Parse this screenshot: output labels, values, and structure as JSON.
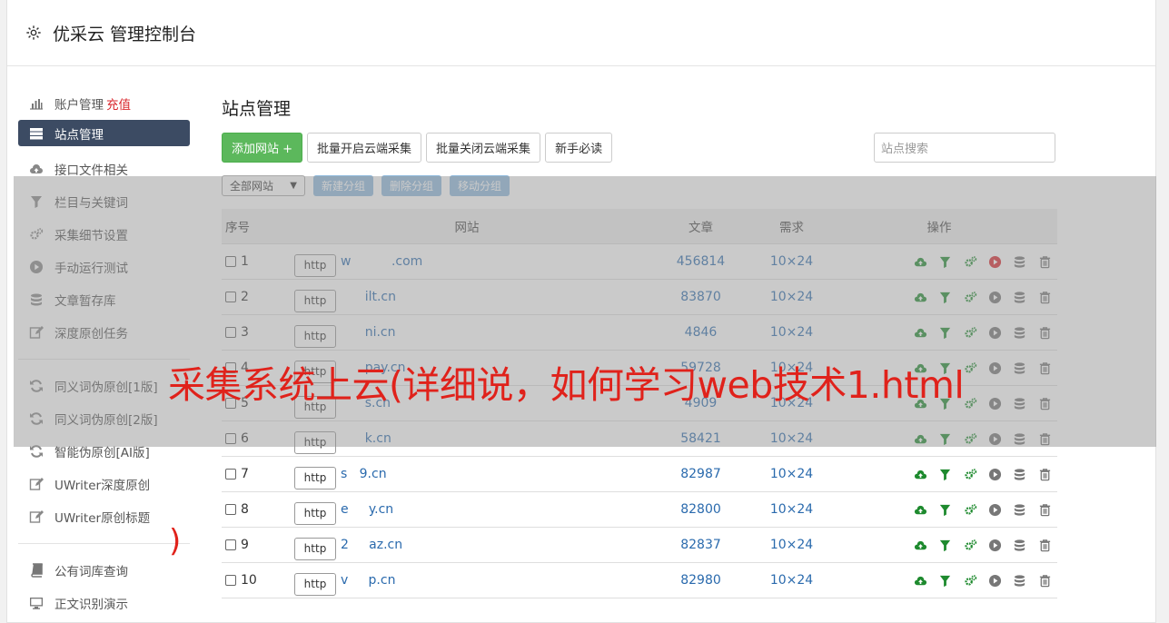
{
  "header": {
    "title": "优采云 管理控制台"
  },
  "sidebar": {
    "items": [
      {
        "label": "账户管理",
        "extra": "充值",
        "icon": "bar-chart-icon"
      },
      {
        "label": "站点管理",
        "icon": "server-icon",
        "active": true
      },
      {
        "label": "接口文件相关",
        "icon": "cloud-upload-icon"
      },
      {
        "label": "栏目与关键词",
        "icon": "filter-icon"
      },
      {
        "label": "采集细节设置",
        "icon": "gears-icon"
      },
      {
        "label": "手动运行测试",
        "icon": "play-circle-icon"
      },
      {
        "label": "文章暂存库",
        "icon": "database-icon"
      },
      {
        "label": "深度原创任务",
        "icon": "edit-icon"
      }
    ],
    "items2": [
      {
        "label": "同义词伪原创[1版]",
        "icon": "refresh-icon"
      },
      {
        "label": "同义词伪原创[2版]",
        "icon": "refresh-icon"
      },
      {
        "label": "智能伪原创[AI版]",
        "icon": "refresh-icon"
      },
      {
        "label": "UWriter深度原创",
        "icon": "edit-icon"
      },
      {
        "label": "UWriter原创标题",
        "icon": "edit-icon"
      }
    ],
    "items3": [
      {
        "label": "公有词库查询",
        "icon": "book-icon"
      },
      {
        "label": "正文识别演示",
        "icon": "monitor-icon"
      }
    ]
  },
  "main": {
    "title": "站点管理",
    "buttons": {
      "add": "添加网站 +",
      "batch_open": "批量开启云端采集",
      "batch_close": "批量关闭云端采集",
      "guide": "新手必读"
    },
    "search_placeholder": "站点搜索",
    "group_select": "全部网站",
    "group_buttons": {
      "new": "新建分组",
      "delete": "删除分组",
      "move": "移动分组"
    },
    "columns": {
      "no": "序号",
      "site": "网站",
      "articles": "文章",
      "demand": "需求",
      "ops": "操作"
    },
    "rows": [
      {
        "no": "1",
        "proto": "http",
        "domain": "w          .com",
        "articles": "456814",
        "demand": "10×24",
        "running": true
      },
      {
        "no": "2",
        "proto": "http",
        "domain": "      ilt.cn",
        "articles": "83870",
        "demand": "10×24",
        "running": false
      },
      {
        "no": "3",
        "proto": "http",
        "domain": "      ni.cn",
        "articles": "4846",
        "demand": "10×24",
        "running": false
      },
      {
        "no": "4",
        "proto": "http",
        "domain": "      pay.cn",
        "articles": "59728",
        "demand": "10×24",
        "running": false
      },
      {
        "no": "5",
        "proto": "http",
        "domain": "      s.cn",
        "articles": "4909",
        "demand": "10×24",
        "running": false
      },
      {
        "no": "6",
        "proto": "http",
        "domain": "      k.cn",
        "articles": "58421",
        "demand": "10×24",
        "running": false
      },
      {
        "no": "7",
        "proto": "http",
        "domain": "s   9.cn",
        "articles": "82987",
        "demand": "10×24",
        "running": false
      },
      {
        "no": "8",
        "proto": "http",
        "domain": "e     y.cn",
        "articles": "82800",
        "demand": "10×24",
        "running": false
      },
      {
        "no": "9",
        "proto": "http",
        "domain": "2     az.cn",
        "articles": "82837",
        "demand": "10×24",
        "running": false
      },
      {
        "no": "10",
        "proto": "http",
        "domain": "v     p.cn",
        "articles": "82980",
        "demand": "10×24",
        "running": false
      }
    ]
  },
  "watermark": {
    "text": "采集系统上云(详细说，如何学习web技术1.html",
    "paren": ")"
  },
  "colors": {
    "sidebar_active": "#3c4b63",
    "green": "#5cb85c",
    "link": "#2a6aad",
    "red": "#e0221b"
  }
}
